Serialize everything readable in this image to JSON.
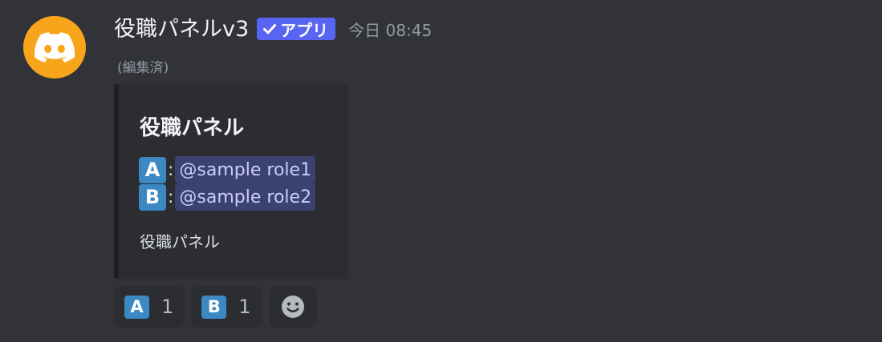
{
  "message": {
    "author": "役職パネルv3",
    "badge": {
      "icon": "check-icon",
      "label": "アプリ",
      "color": "#5865f2"
    },
    "timestamp": "今日 08:45",
    "edited_label": "(編集済)",
    "avatar": {
      "icon": "discord-logo-icon",
      "color": "#f9a51b"
    }
  },
  "embed": {
    "title": "役職パネル",
    "roles": [
      {
        "emoji": "A",
        "separator": ":",
        "mention": "@sample role1"
      },
      {
        "emoji": "B",
        "separator": ":",
        "mention": "@sample role2"
      }
    ],
    "description": "役職パネル"
  },
  "reactions": [
    {
      "emoji": "A",
      "count": "1"
    },
    {
      "emoji": "B",
      "count": "1"
    }
  ],
  "add_reaction": {
    "icon": "smiley-face-icon"
  },
  "colors": {
    "background": "#313338",
    "embed_background": "#2b2d31",
    "mention_background": "#3c4270",
    "emoji_blue": "#3b88c3"
  }
}
